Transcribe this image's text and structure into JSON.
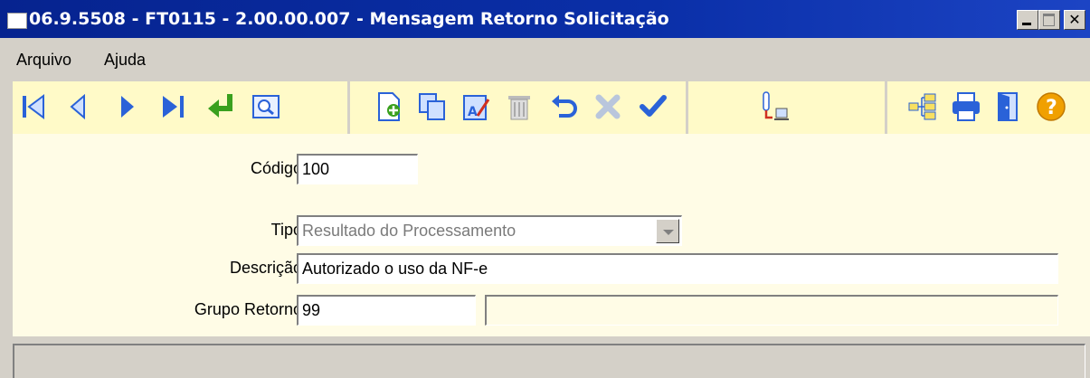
{
  "window": {
    "title": "06.9.5508 - FT0115 - 2.00.00.007 - Mensagem Retorno Solicitação"
  },
  "menu": {
    "arquivo": "Arquivo",
    "ajuda": "Ajuda"
  },
  "toolbar": {
    "icons": [
      "first-record-icon",
      "previous-record-icon",
      "next-record-icon",
      "last-record-icon",
      "go-to-icon",
      "search-icon",
      "new-record-icon",
      "copy-icon",
      "edit-icon",
      "delete-icon",
      "undo-icon",
      "cancel-icon",
      "confirm-icon",
      "query-icon",
      "tree-icon",
      "print-icon",
      "exit-icon",
      "help-icon"
    ],
    "colors": {
      "background": "#fffac8",
      "blue": "#2a62d8",
      "green": "#3aa01e",
      "orange": "#f0a000"
    }
  },
  "form": {
    "codigo": {
      "label": "Código:",
      "value": "100"
    },
    "tipo": {
      "label": "Tipo:",
      "value": "Resultado do Processamento"
    },
    "descricao": {
      "label": "Descrição:",
      "value": "Autorizado o uso da NF-e"
    },
    "grupo_retorno": {
      "label": "Grupo Retorno:",
      "value": "99",
      "description": ""
    }
  },
  "status": {
    "text": ""
  }
}
